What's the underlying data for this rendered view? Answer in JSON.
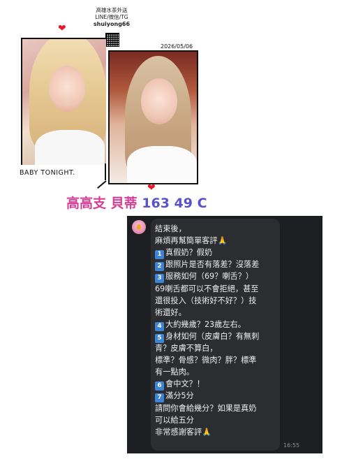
{
  "header": {
    "line1": "高雄水茶外送",
    "line2": "LINE/微信/TG",
    "handle": "shuiyong66"
  },
  "hearts": {
    "glyph": "❤"
  },
  "date": "2026/05/06",
  "caption": "BABY TONIGHT.",
  "headline": {
    "name": "高高支 貝蒂",
    "stats": "163 49 C"
  },
  "chat": {
    "time": "16:55",
    "lines": [
      {
        "badge": "",
        "text": "結束後，"
      },
      {
        "badge": "",
        "text": "麻煩再幫簡單客評🙏"
      },
      {
        "badge": "1",
        "text": "真假奶？假奶"
      },
      {
        "badge": "2",
        "text": "跟照片是否有落差？沒落差"
      },
      {
        "badge": "3",
        "text": "服務如何（69？喇舌？）"
      },
      {
        "badge": "",
        "text": "69喇舌都可以不會拒絕，甚至"
      },
      {
        "badge": "",
        "text": "還很投入（技術好不好？）技"
      },
      {
        "badge": "",
        "text": "術還好。"
      },
      {
        "badge": "4",
        "text": "大約幾歲？23歲左右。"
      },
      {
        "badge": "5",
        "text": "身材如何（皮膚白？有無刺"
      },
      {
        "badge": "",
        "text": "青？皮膚不算白，"
      },
      {
        "badge": "",
        "text": "標準？骨感？微肉？胖？標準"
      },
      {
        "badge": "",
        "text": "有一點肉。"
      },
      {
        "badge": "6",
        "text": "會中文？！"
      },
      {
        "badge": "7",
        "text": "滿分5分"
      },
      {
        "badge": "",
        "text": "請問你會給幾分？如果是真奶"
      },
      {
        "badge": "",
        "text": "可以給五分"
      },
      {
        "badge": "",
        "text": "非常感謝客評🙏"
      }
    ]
  }
}
